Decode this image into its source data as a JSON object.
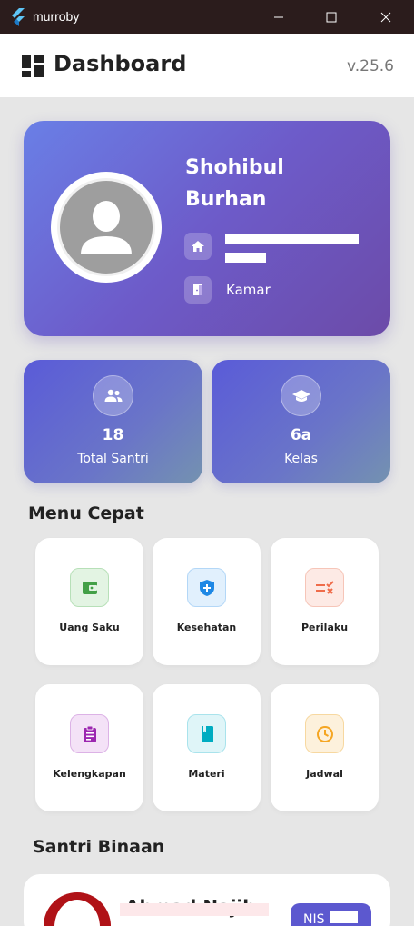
{
  "window": {
    "title": "murroby",
    "minimize_icon": "minimize-icon",
    "maximize_icon": "maximize-icon",
    "close_icon": "close-icon"
  },
  "header": {
    "icon": "dashboard-icon",
    "title": "Dashboard",
    "version": "v.25.6"
  },
  "profile": {
    "name": "Shohibul Burhan",
    "address_icon": "home-icon",
    "address": "",
    "room_icon": "door-icon",
    "room_label": "Kamar"
  },
  "stats": [
    {
      "icon": "group-icon",
      "value": "18",
      "label": "Total Santri"
    },
    {
      "icon": "graduation-cap-icon",
      "value": "6a",
      "label": "Kelas"
    }
  ],
  "menu": {
    "title": "Menu Cepat",
    "items": [
      {
        "label": "Uang Saku",
        "icon": "wallet-icon",
        "color": "#4caf50"
      },
      {
        "label": "Kesehatan",
        "icon": "shield-plus-icon",
        "color": "#2196f3"
      },
      {
        "label": "Perilaku",
        "icon": "checklist-icon",
        "color": "#ef6c4a"
      },
      {
        "label": "Kelengkapan",
        "icon": "clipboard-icon",
        "color": "#9c27b0"
      },
      {
        "label": "Materi",
        "icon": "book-icon",
        "color": "#00acc1"
      },
      {
        "label": "Jadwal",
        "icon": "clock-icon",
        "color": "#f5a623"
      }
    ]
  },
  "binaan": {
    "title": "Santri Binaan",
    "items": [
      {
        "name": "Ahmad Najib",
        "nis_label": "NIS :"
      }
    ]
  }
}
